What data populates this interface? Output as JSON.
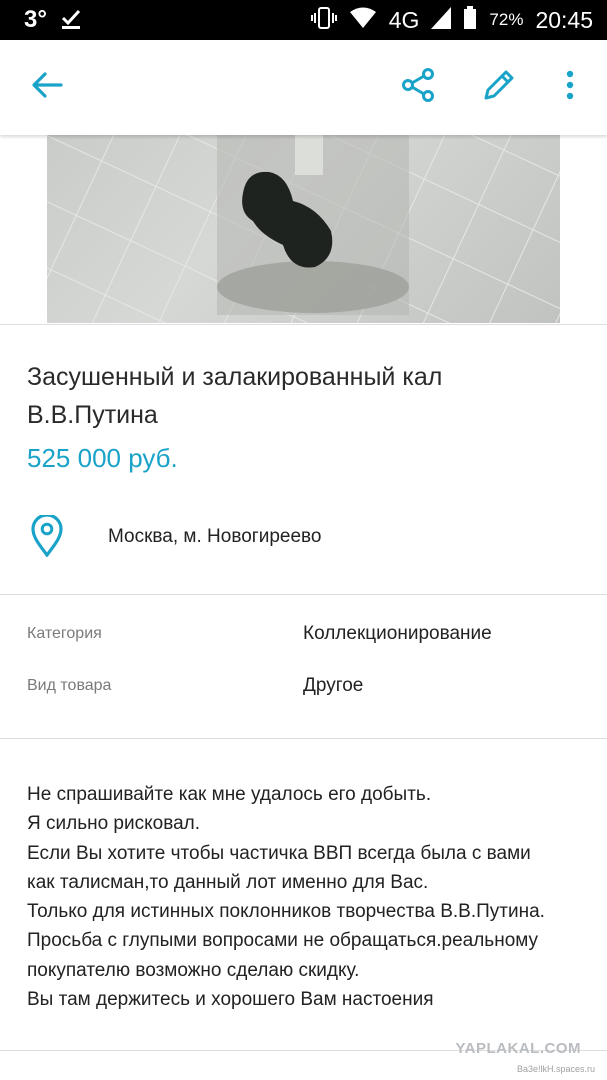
{
  "status_bar": {
    "temperature": "3°",
    "signal_label": "4G",
    "battery": "72%",
    "time": "20:45"
  },
  "app_bar": {
    "back_icon": "arrow-left-icon",
    "share_icon": "share-icon",
    "edit_icon": "pencil-icon",
    "menu_icon": "more-vertical-icon"
  },
  "listing": {
    "title_line1": "Засушенный и залакированный кал",
    "title_line2": "В.В.Путина",
    "price": "525 000 руб.",
    "location": "Москва, м. Новогиреево"
  },
  "attributes": [
    {
      "label": "Категория",
      "value": "Коллекционирование"
    },
    {
      "label": "Вид товара",
      "value": "Другое"
    }
  ],
  "description": [
    "Не спрашивайте как мне удалось его добыть.",
    "Я сильно рисковал.",
    "Если Вы хотите чтобы частичка ВВП всегда была с вами",
    "как талисман,то данный лот именно для Вас.",
    "Только для истинных поклонников творчества В.В.Путина.",
    "Просьба с глупыми вопросами не обращаться.реальному",
    "покупателю возможно сделаю скидку.",
    "Вы там держитесь и хорошего Вам настоения"
  ],
  "watermark": {
    "main": "YAPLAKAL.COM",
    "sub": "Ba3e!lkH.spaces.ru"
  },
  "colors": {
    "accent": "#1aa3c8",
    "status_bar_bg": "#000000"
  }
}
